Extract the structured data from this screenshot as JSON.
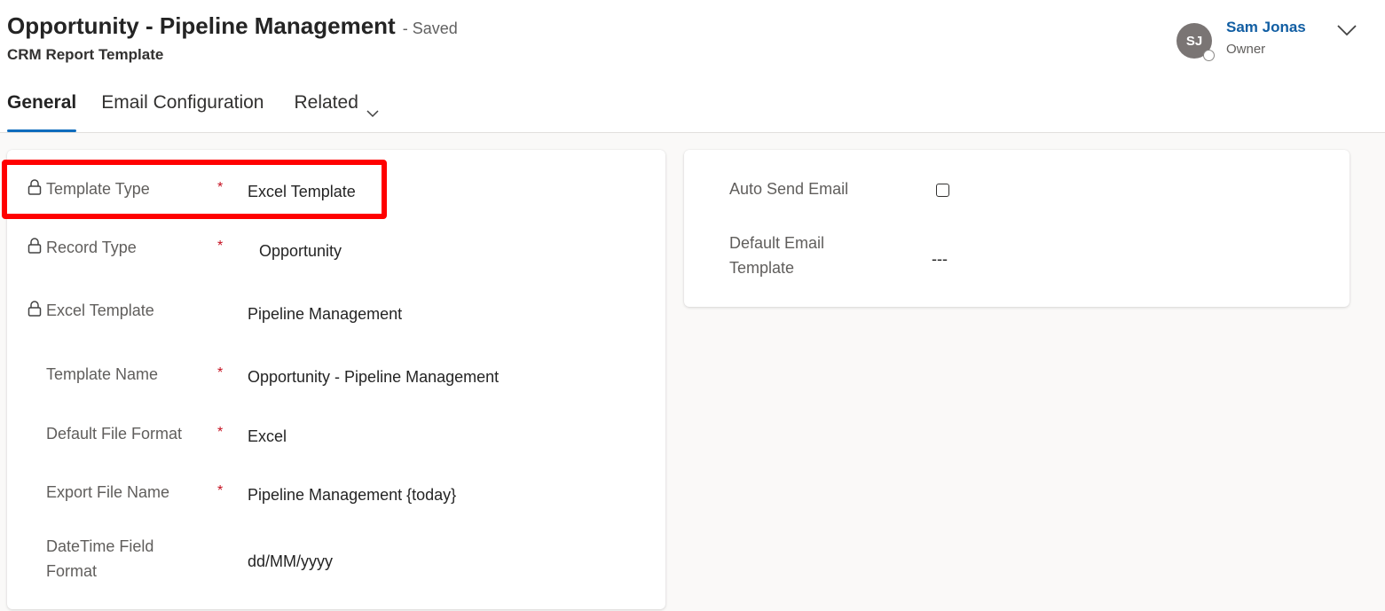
{
  "header": {
    "title": "Opportunity - Pipeline Management",
    "status": "- Saved",
    "subtitle": "CRM Report Template",
    "owner": {
      "initials": "SJ",
      "name": "Sam Jonas",
      "role": "Owner"
    }
  },
  "tabs": [
    {
      "label": "General",
      "active": true
    },
    {
      "label": "Email Configuration",
      "active": false
    },
    {
      "label": "Related",
      "active": false
    }
  ],
  "general": {
    "template_type": {
      "label": "Template Type",
      "required": "*",
      "value": "Excel Template",
      "locked": true
    },
    "record_type": {
      "label": "Record Type",
      "required": "*",
      "value": "Opportunity",
      "locked": true
    },
    "excel_template": {
      "label": "Excel Template",
      "value": "Pipeline Management",
      "locked": true
    },
    "template_name": {
      "label": "Template Name",
      "required": "*",
      "value": "Opportunity - Pipeline Management"
    },
    "default_file_format": {
      "label": "Default File Format",
      "required": "*",
      "value": "Excel"
    },
    "export_file_name": {
      "label": "Export File Name",
      "required": "*",
      "value": "Pipeline Management {today}"
    },
    "datetime_format": {
      "label_line1": "DateTime Field",
      "label_line2": "Format",
      "value": "dd/MM/yyyy"
    }
  },
  "email": {
    "auto_send": {
      "label": "Auto Send Email",
      "checked": false
    },
    "default_template": {
      "label_line1": "Default Email",
      "label_line2": "Template",
      "value": "---"
    }
  },
  "colors": {
    "accent": "#0f6cbd",
    "required": "#c50f1f",
    "highlight": "#ff0000",
    "link": "#115ea3"
  }
}
